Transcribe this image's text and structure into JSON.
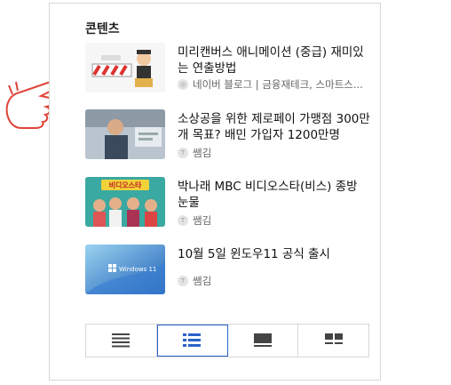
{
  "panel": {
    "title": "콘텐츠"
  },
  "items": [
    {
      "title": "미리캔버스 애니메이션 (중급) 재미있는 연출방법",
      "meta": "네이버 블로그 | 금융재테크, 스마트스..."
    },
    {
      "title": "소상공을 위한 제로페이 가맹점 300만개 목표? 배민 가입자 1200만명",
      "meta": "쌤김"
    },
    {
      "title": "박나래 MBC 비디오스타(비스) 종방 눈물",
      "meta": "쌤김"
    },
    {
      "title": "10월 5일 윈도우11 공식 출시",
      "meta": "쌤김"
    }
  ],
  "thumb_text": {
    "video_star": "비디오스타",
    "windows": "Windows 11"
  },
  "tabs": [
    {
      "name": "list-icon"
    },
    {
      "name": "detail-list-icon",
      "active": true
    },
    {
      "name": "card-icon"
    },
    {
      "name": "album-icon"
    }
  ],
  "colors": {
    "accent": "#2a62c9",
    "arrow": "#2bb5d8",
    "hand": "#e0443a"
  }
}
